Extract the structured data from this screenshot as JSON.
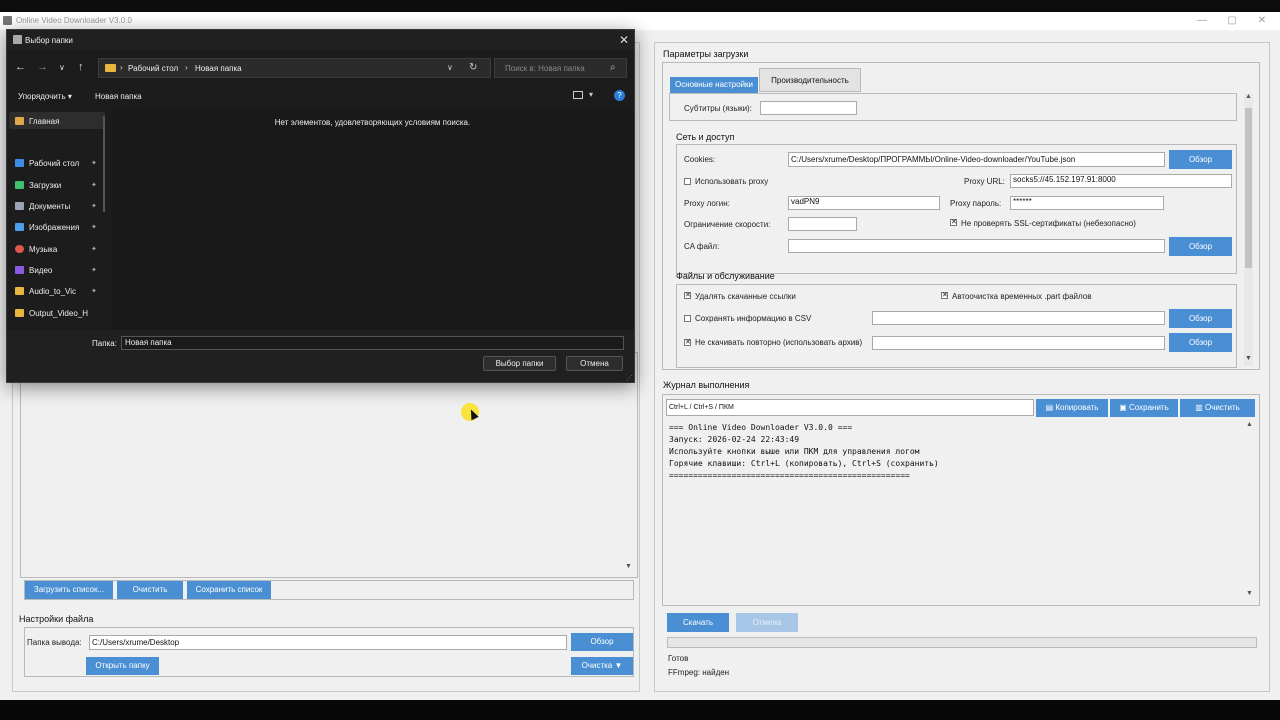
{
  "window": {
    "title": "Online Video Downloader V3.0.0",
    "controls": [
      "—",
      "▢",
      "✕"
    ]
  },
  "left": {
    "list_buttons": {
      "load": "Загрузить список...",
      "clear": "Очистить",
      "save": "Сохранить список"
    },
    "file_settings": {
      "title": "Настройки файла",
      "output_label": "Папка вывода:",
      "output_value": "C:/Users/xrume/Desktop",
      "browse": "Обзор",
      "open_folder": "Открыть папку",
      "cleanup": "Очистка ▼"
    }
  },
  "right": {
    "params_title": "Параметры загрузки",
    "tabs": [
      "Основные настройки",
      "Производительность"
    ],
    "subtitles_label": "Субтитры (языки):",
    "subtitles_value": "",
    "network": {
      "title": "Сеть и доступ",
      "cookies_label": "Cookies:",
      "cookies_value": "C:/Users/xrume/Desktop/ПРОГРАММЫ/Online-Video-downloader/YouTube.json",
      "browse": "Обзор",
      "use_proxy_label": "Использовать proxy",
      "proxy_url_label": "Proxy URL:",
      "proxy_url_value": "socks5://45.152.197.91:8000",
      "proxy_login_label": "Proxy логин:",
      "proxy_login_value": "vadPN9",
      "proxy_password_label": "Proxy пароль:",
      "proxy_password_value": "******",
      "speed_limit_label": "Ограничение скорости:",
      "speed_limit_value": "",
      "ssl_label": "Не проверять SSL-сертификаты (небезопасно)",
      "ca_label": "CA файл:",
      "ca_value": ""
    },
    "files": {
      "title": "Файлы и обслуживание",
      "delete_links_label": "Удалять скачанные ссылки",
      "autoclean_label": "Автоочистка временных .part файлов",
      "save_csv_label": "Сохранять информацию в CSV",
      "no_redownload_label": "Не скачивать повторно (использовать архив)",
      "browse": "Обзор"
    },
    "log": {
      "title": "Журнал выполнения",
      "hint": "Ctrl+L / Ctrl+S / ПКМ",
      "copy": "Копировать",
      "save": "Сохранить",
      "clear": "Очистить",
      "lines": [
        "=== Online Video Downloader V3.0.0 ===",
        "Запуск: 2026-02-24 22:43:49",
        "Используйте кнопки выше или ПКМ для управления логом",
        "Горячие клавиши: Ctrl+L (копировать), Ctrl+S (сохранить)",
        "=================================================="
      ]
    },
    "download": "Скачать",
    "cancel": "Отмена",
    "status": "Готов",
    "ffmpeg": "FFmpeg: найден"
  },
  "dialog": {
    "title": "Выбор папки",
    "breadcrumb": [
      "Рабочий стол",
      "Новая папка"
    ],
    "search_placeholder": "Поиск в: Новая папка",
    "organize": "Упорядочить ▾",
    "new_folder": "Новая папка",
    "empty_message": "Нет элементов, удовлетворяющих условиям поиска.",
    "sidebar": [
      {
        "label": "Главная",
        "icon": "home-icon",
        "color": "#e0a84a"
      },
      {
        "label": "Рабочий стол",
        "icon": "desktop-icon",
        "color": "#3a8ee6"
      },
      {
        "label": "Загрузки",
        "icon": "download-icon",
        "color": "#3fbf6f"
      },
      {
        "label": "Документы",
        "icon": "document-icon",
        "color": "#9aa4b2"
      },
      {
        "label": "Изображения",
        "icon": "image-icon",
        "color": "#4aa0e6"
      },
      {
        "label": "Музыка",
        "icon": "music-icon",
        "color": "#e0584a"
      },
      {
        "label": "Видео",
        "icon": "video-icon",
        "color": "#8a5ae0"
      },
      {
        "label": "Audio_to_Vic",
        "icon": "folder-icon",
        "color": "#e8b63e"
      },
      {
        "label": "Output_Video_H",
        "icon": "folder-icon",
        "color": "#e8b63e"
      }
    ],
    "folder_label": "Папка:",
    "folder_value": "Новая папка",
    "select_button": "Выбор папки",
    "cancel_button": "Отмена"
  }
}
